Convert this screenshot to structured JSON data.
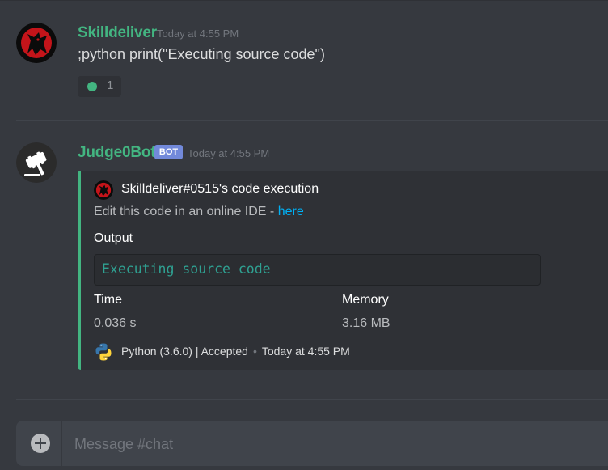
{
  "messages": [
    {
      "author": "Skilldeliver",
      "timestamp": "Today at 4:55 PM",
      "content": ";python print(\"Executing source code\")",
      "reaction": {
        "emoji": "green-circle",
        "count": "1"
      }
    },
    {
      "author": "Judge0Bot",
      "badge": "BOT",
      "timestamp": "Today at 4:55 PM",
      "embed": {
        "author_name": "Skilldeliver#0515's code execution",
        "description_text": "Edit this code in an online IDE - ",
        "description_link": "here",
        "output_label": "Output",
        "output_code": "Executing source code",
        "time_label": "Time",
        "time_value": "0.036 s",
        "memory_label": "Memory",
        "memory_value": "3.16 MB",
        "footer_text": "Python (3.6.0) | Accepted",
        "footer_separator": "•",
        "footer_timestamp": "Today at 4:55 PM"
      }
    }
  ],
  "composer": {
    "placeholder": "Message #chat"
  },
  "colors": {
    "background": "#36393f",
    "author": "#43b581",
    "embed_accent": "#43b581",
    "bot_badge": "#7289da",
    "link": "#00b0f4",
    "code": "#2fa192"
  },
  "icons": {
    "upload": "plus-circle-icon",
    "footer": "python-logo-icon"
  }
}
